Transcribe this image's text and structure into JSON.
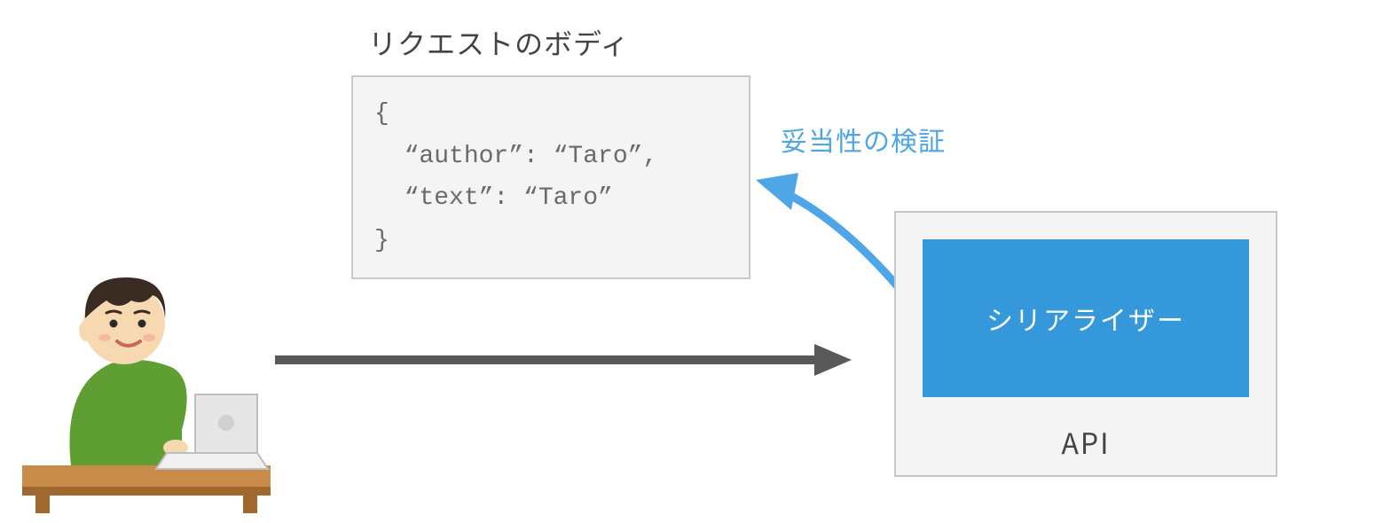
{
  "request": {
    "title": "リクエストのボディ",
    "body_text": "{\n  “author”: “Taro”,\n  “text”: “Taro”\n}"
  },
  "validation": {
    "label": "妥当性の検証"
  },
  "api": {
    "label": "API",
    "serializer_label": "シリアライザー"
  },
  "colors": {
    "accent_blue": "#3498DB",
    "code_bg": "#F4F4F4",
    "border_grey": "#C8C8C8",
    "arrow_dark": "#595959",
    "arrow_blue": "#4EA6E6"
  }
}
